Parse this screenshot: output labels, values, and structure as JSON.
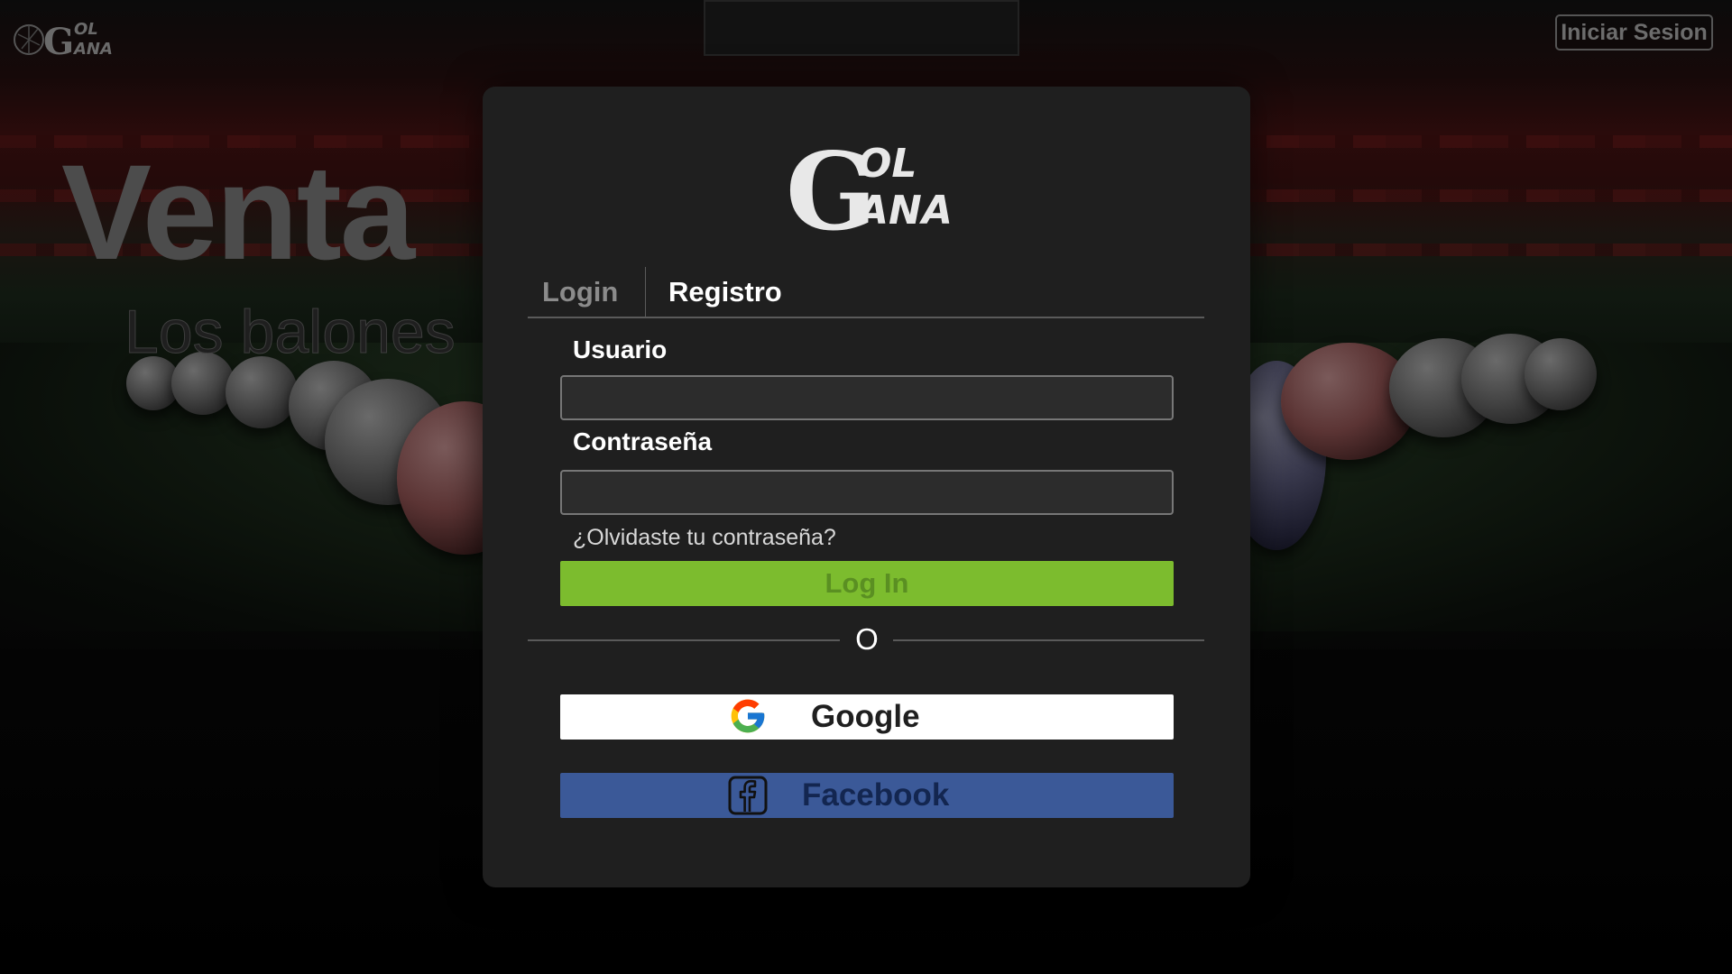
{
  "brand": {
    "logo_icon": "golgana-logo-icon",
    "logo_text_top": "OL",
    "logo_text_bottom": "ANA",
    "logo_letter": "G"
  },
  "header": {
    "login_button": "Iniciar Sesion"
  },
  "hero": {
    "title": "Venta",
    "subtitle": "Los balones"
  },
  "modal": {
    "logo_letter": "G",
    "logo_text_top": "OL",
    "logo_text_bottom": "ANA",
    "tabs": [
      {
        "label": "Login",
        "active": false
      },
      {
        "label": "Registro",
        "active": true
      }
    ],
    "username_label": "Usuario",
    "username_value": "",
    "password_label": "Contraseña",
    "password_value": "",
    "forgot_password": "¿Olvidaste tu contraseña?",
    "login_button": "Log In",
    "separator": "O",
    "google_button": "Google",
    "google_icon": "google-icon",
    "facebook_button": "Facebook",
    "facebook_icon": "facebook-icon"
  },
  "colors": {
    "modal_bg": "#1f1f1f",
    "login_green": "#7cbc2e",
    "facebook_blue": "#3b5998",
    "google_white": "#ffffff"
  }
}
